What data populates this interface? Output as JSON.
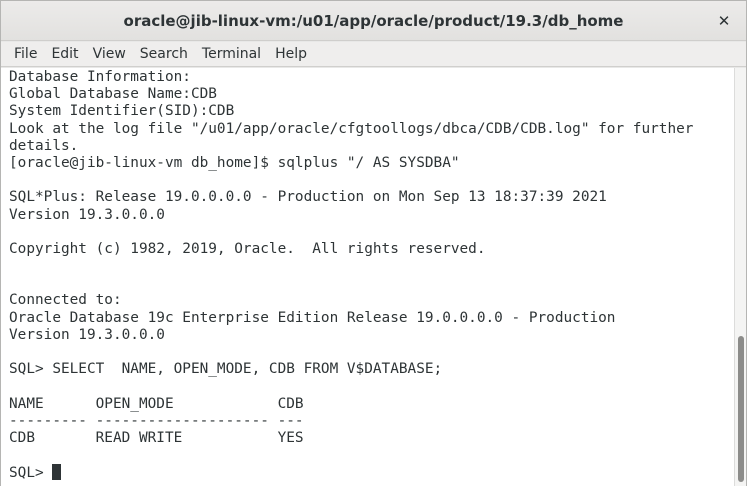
{
  "window": {
    "title": "oracle@jib-linux-vm:/u01/app/oracle/product/19.3/db_home",
    "close_label": "✕"
  },
  "menu": {
    "items": [
      "File",
      "Edit",
      "View",
      "Search",
      "Terminal",
      "Help"
    ]
  },
  "terminal": {
    "lines": [
      "Database Information:",
      "Global Database Name:CDB",
      "System Identifier(SID):CDB",
      "Look at the log file \"/u01/app/oracle/cfgtoollogs/dbca/CDB/CDB.log\" for further",
      "details.",
      "[oracle@jib-linux-vm db_home]$ sqlplus \"/ AS SYSDBA\"",
      "",
      "SQL*Plus: Release 19.0.0.0.0 - Production on Mon Sep 13 18:37:39 2021",
      "Version 19.3.0.0.0",
      "",
      "Copyright (c) 1982, 2019, Oracle.  All rights reserved.",
      "",
      "",
      "Connected to:",
      "Oracle Database 19c Enterprise Edition Release 19.0.0.0.0 - Production",
      "Version 19.3.0.0.0",
      "",
      "SQL> SELECT  NAME, OPEN_MODE, CDB FROM V$DATABASE;",
      "",
      "NAME      OPEN_MODE            CDB",
      "--------- -------------------- ---",
      "CDB       READ WRITE           YES",
      ""
    ],
    "prompt": "SQL> "
  }
}
